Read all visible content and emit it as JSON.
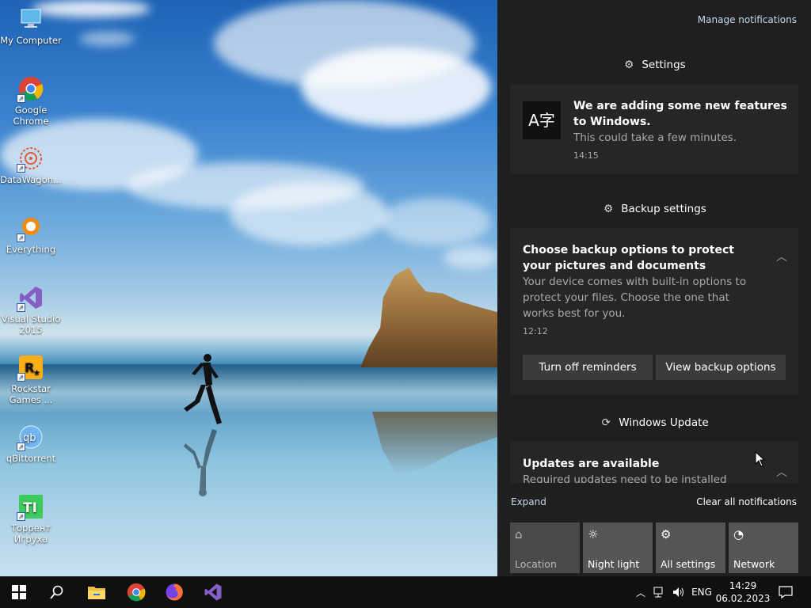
{
  "desktop": {
    "icons": [
      {
        "label": "My Computer"
      },
      {
        "label": "Google Chrome"
      },
      {
        "label": "DataWagon..."
      },
      {
        "label": "Everything"
      },
      {
        "label": "Visual Studio 2015"
      },
      {
        "label": "Rockstar Games ..."
      },
      {
        "label": "qBittorrent"
      },
      {
        "label": "Торрент Игруха"
      }
    ]
  },
  "action_center": {
    "manage_label": "Manage notifications",
    "groups": [
      {
        "title": "Settings",
        "icon": "gear-icon",
        "notification": {
          "title": "We are adding some new features to Windows.",
          "body": "This could take a few minutes.",
          "time": "14:15",
          "icon_text": "A字"
        }
      },
      {
        "title": "Backup settings",
        "icon": "gear-icon",
        "notification": {
          "title": "Choose backup options to protect your pictures and documents",
          "body": "Your device comes with built-in options to protect your files. Choose the one that works best for you.",
          "time": "12:12",
          "buttons": [
            "Turn off reminders",
            "View backup options"
          ]
        }
      },
      {
        "title": "Windows Update",
        "icon": "update-icon",
        "notification": {
          "title": "Updates are available",
          "body": "Required updates need to be installed"
        }
      }
    ],
    "expand_label": "Expand",
    "clear_label": "Clear all notifications",
    "quick_actions": [
      {
        "label": "Location",
        "icon": "location-icon",
        "state": "off"
      },
      {
        "label": "Night light",
        "icon": "night-light-icon",
        "state": "on"
      },
      {
        "label": "All settings",
        "icon": "gear-icon",
        "state": "on"
      },
      {
        "label": "Network",
        "icon": "network-icon",
        "state": "on"
      }
    ]
  },
  "taskbar": {
    "language": "ENG",
    "time": "14:29",
    "date": "06.02.2023"
  },
  "colors": {
    "accent": "#0078d7",
    "link": "#c8d9ef",
    "panel_bg": "#1f1f1f"
  }
}
